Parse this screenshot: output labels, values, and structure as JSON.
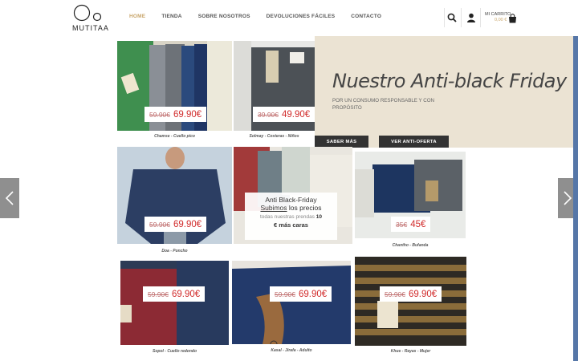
{
  "brand": {
    "logo_text": "MUTITAA"
  },
  "nav": {
    "items": [
      {
        "label": "HOME",
        "active": true
      },
      {
        "label": "TIENDA",
        "active": false
      },
      {
        "label": "SOBRE NOSOTROS",
        "active": false
      },
      {
        "label": "DEVOLUCIONES FÁCILES",
        "active": false
      },
      {
        "label": "CONTACTO",
        "active": false
      }
    ]
  },
  "cart": {
    "label": "MI CARRITO",
    "amount": "0,00 €"
  },
  "hero": {
    "title": "Nuestro Anti-black Friday",
    "subtitle": "POR UN CONSUMO RESPONSABLE Y CON PROPÓSITO",
    "btn_more": "SABER MÁS",
    "btn_offer": "VER ANTI-OFERTA"
  },
  "products": [
    {
      "id": "p1",
      "old": "59.90€",
      "new": "69.90€",
      "caption": "Chamse - Cuello pico"
    },
    {
      "id": "p2",
      "old": "39.90€",
      "new": "49.90€",
      "caption": "Solmay - Costeras - Niños"
    },
    {
      "id": "p3",
      "old": "59.90€",
      "new": "69.90€",
      "caption": "Doa - Poncho"
    },
    {
      "id": "p4",
      "old": "35€",
      "new": "45€",
      "caption": "Chantho - Bufanda"
    },
    {
      "id": "p5",
      "old": "59.90€",
      "new": "69.90€",
      "caption": "Sopol - Cuello redondo"
    },
    {
      "id": "p6",
      "old": "59.90€",
      "new": "69.90€",
      "caption": "Kasal - Jirafa - Adulto"
    },
    {
      "id": "p7",
      "old": "59.90€",
      "new": "69.90€",
      "caption": "Khue - Rayas - Mujer"
    }
  ],
  "promo": {
    "line1": "Anti Black-Friday",
    "line2_u": "Subimos",
    "line2_rest": " los precios",
    "line3": "todas nuestras prendas",
    "line3_num": "10",
    "line4": "€ más caras"
  },
  "colors": {
    "accent": "#c8a56a",
    "price": "#d12b2b",
    "hero_bg": "#ebe3d3"
  },
  "icons": [
    "search-icon",
    "user-icon",
    "cart-icon",
    "chevron-left-icon",
    "chevron-right-icon"
  ]
}
